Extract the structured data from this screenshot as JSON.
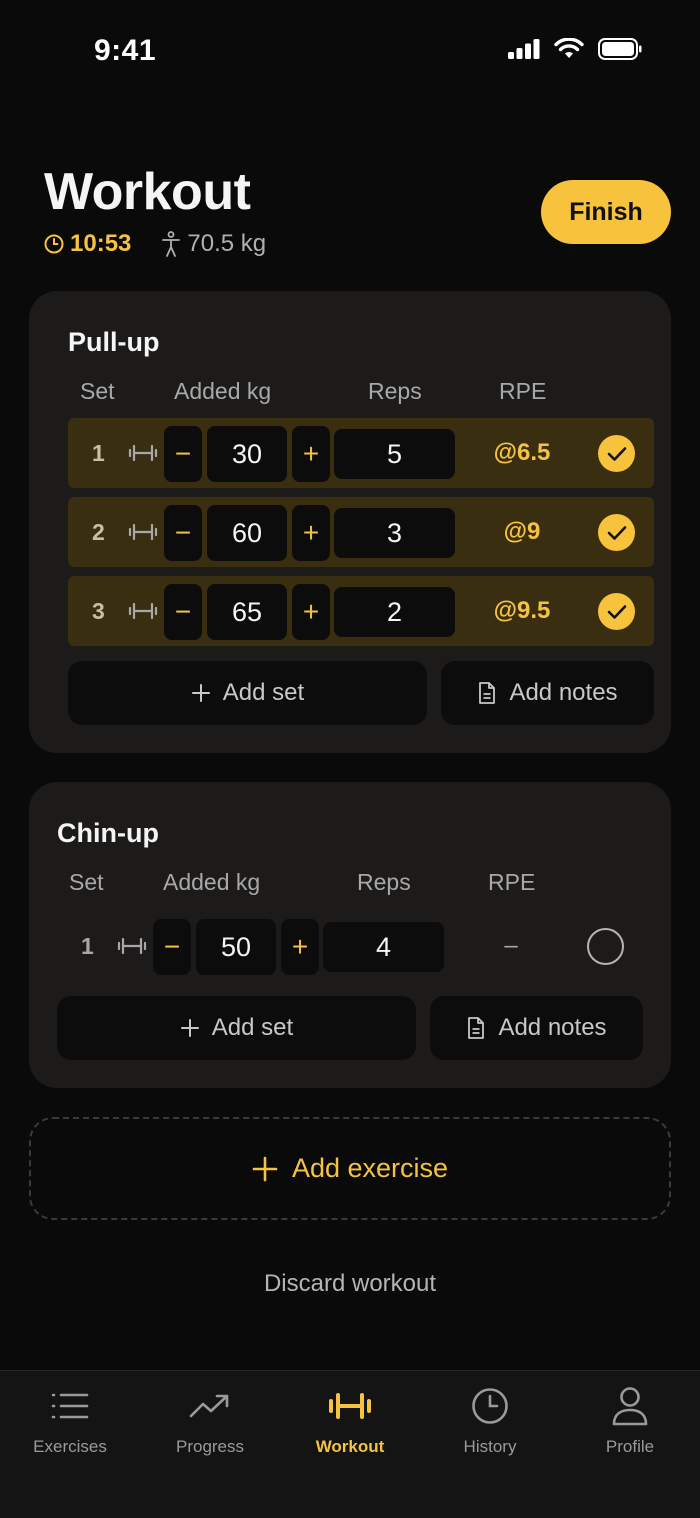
{
  "status": {
    "time": "9:41"
  },
  "header": {
    "title": "Workout",
    "timer": "10:53",
    "bodyweight": "70.5 kg",
    "finish_label": "Finish"
  },
  "columns": {
    "set": "Set",
    "added": "Added kg",
    "reps": "Reps",
    "rpe": "RPE"
  },
  "exercises": [
    {
      "name": "Pull-up",
      "sets": [
        {
          "num": "1",
          "kg": "30",
          "reps": "5",
          "rpe": "@6.5",
          "done": true
        },
        {
          "num": "2",
          "kg": "60",
          "reps": "3",
          "rpe": "@9",
          "done": true
        },
        {
          "num": "3",
          "kg": "65",
          "reps": "2",
          "rpe": "@9.5",
          "done": true
        }
      ],
      "add_set_label": "Add set",
      "add_notes_label": "Add notes"
    },
    {
      "name": "Chin-up",
      "sets": [
        {
          "num": "1",
          "kg": "50",
          "reps": "4",
          "rpe": "–",
          "done": false
        }
      ],
      "add_set_label": "Add set",
      "add_notes_label": "Add notes"
    }
  ],
  "add_exercise_label": "Add exercise",
  "discard_label": "Discard workout",
  "tabs": [
    {
      "label": "Exercises",
      "icon": "list-icon",
      "active": false
    },
    {
      "label": "Progress",
      "icon": "trend-icon",
      "active": false
    },
    {
      "label": "Workout",
      "icon": "dumbbell-icon",
      "active": true
    },
    {
      "label": "History",
      "icon": "clock-icon",
      "active": false
    },
    {
      "label": "Profile",
      "icon": "person-icon",
      "active": false
    }
  ],
  "colors": {
    "accent": "#f7c23c",
    "background": "#0a0a0a",
    "card": "#1c1b1a",
    "done_row": "#3a2e10"
  }
}
